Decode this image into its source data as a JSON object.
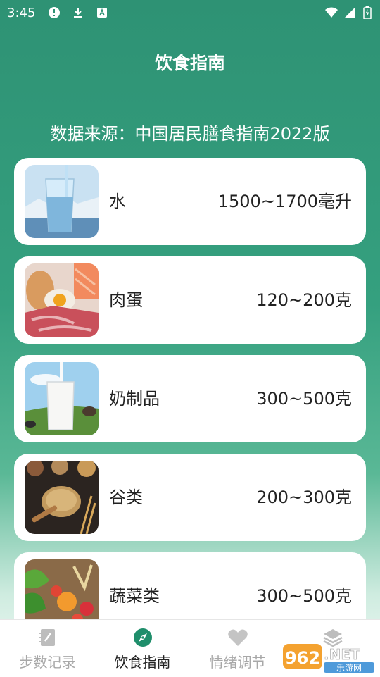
{
  "status": {
    "time": "3:45"
  },
  "header": {
    "title": "饮食指南",
    "source": "数据来源：中国居民膳食指南2022版"
  },
  "items": [
    {
      "name": "水",
      "amount": "1500~1700毫升"
    },
    {
      "name": "肉蛋",
      "amount": "120~200克"
    },
    {
      "name": "奶制品",
      "amount": "300~500克"
    },
    {
      "name": "谷类",
      "amount": "200~300克"
    },
    {
      "name": "蔬菜类",
      "amount": "300~500克"
    }
  ],
  "nav": [
    {
      "label": "步数记录",
      "icon": "notebook-icon"
    },
    {
      "label": "饮食指南",
      "icon": "compass-icon"
    },
    {
      "label": "情绪调节",
      "icon": "heart-icon"
    },
    {
      "label": "",
      "icon": "layers-icon"
    }
  ],
  "active_tab": "饮食指南",
  "watermark": {
    "text": "962.NET",
    "subtext": "乐游网"
  },
  "colors": {
    "theme": "#2e9274",
    "accent": "#1f8e6b"
  }
}
